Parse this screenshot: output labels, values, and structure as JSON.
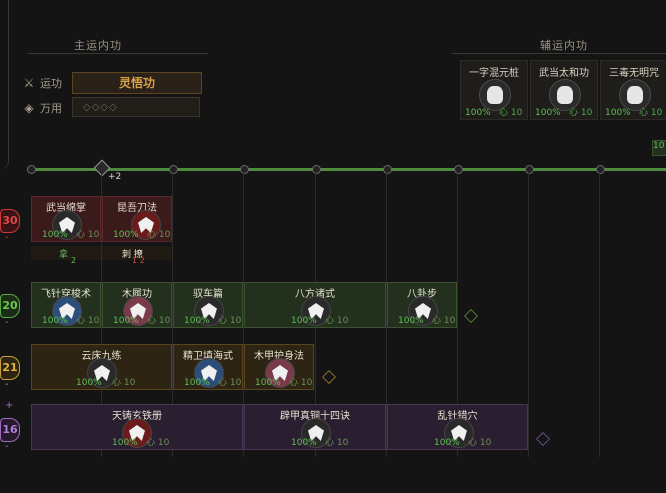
{
  "header": {
    "main_title": "主运内功",
    "aux_title": "辅运内功",
    "yunxing_label": "运功",
    "yunxing_value": "灵悟功",
    "wanyong_label": "万用",
    "wanyong_value": "◇◇◇◇"
  },
  "aux_cards": [
    {
      "name": "一字混元桩",
      "pct": "100%",
      "xin": "心 10"
    },
    {
      "name": "武当太和功",
      "pct": "100%",
      "xin": "心 10"
    },
    {
      "name": "三毒无明咒",
      "pct": "100%",
      "xin": "心 10"
    }
  ],
  "aux_edge_value": "10",
  "timeline": {
    "plus_label": "+2"
  },
  "tiers": [
    {
      "value": "30",
      "color": "#c83a3a"
    },
    {
      "value": "20",
      "color": "#5aa845"
    },
    {
      "value": "21",
      "color": "#c9a03a"
    },
    {
      "value": "16",
      "color": "#a06ac0"
    }
  ],
  "row1": [
    {
      "name": "武当绵掌",
      "pct": "100%",
      "xin": "心 10",
      "sub": "拿",
      "sub_num": "2"
    },
    {
      "name": "昆吾刀法",
      "pct": "100%",
      "xin": "心 10",
      "sub": "刺 撩",
      "sub_num": "1  2"
    }
  ],
  "row2": [
    {
      "name": "飞针穿梭术",
      "pct": "100%",
      "xin": "心 10"
    },
    {
      "name": "木履功",
      "pct": "100%",
      "xin": "心 10"
    },
    {
      "name": "驭车篇",
      "pct": "100%",
      "xin": "心 10"
    },
    {
      "name": "八方诸式",
      "pct": "100%",
      "xin": "心 10"
    },
    {
      "name": "八卦步",
      "pct": "100%",
      "xin": "心 10"
    }
  ],
  "row3": [
    {
      "name": "云床九练",
      "pct": "100%",
      "xin": "心 10"
    },
    {
      "name": "精卫填海式",
      "pct": "100%",
      "xin": "心 10"
    },
    {
      "name": "木甲护身法",
      "pct": "100%",
      "xin": "心 10"
    }
  ],
  "row4": [
    {
      "name": "天铸玄铁册",
      "pct": "100%",
      "xin": "心 10"
    },
    {
      "name": "辟甲真铜十四诀",
      "pct": "100%",
      "xin": "心 10"
    },
    {
      "name": "乱针错穴",
      "pct": "100%",
      "xin": "心 10"
    }
  ]
}
